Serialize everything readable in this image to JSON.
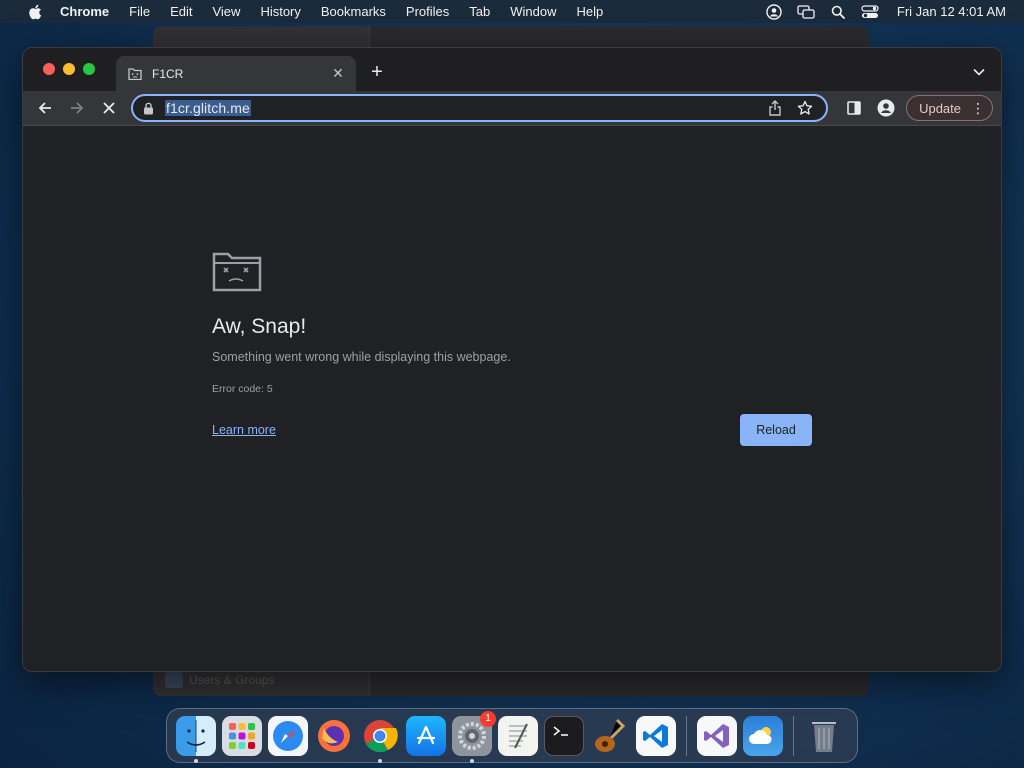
{
  "menubar": {
    "app_name": "Chrome",
    "items": [
      "File",
      "Edit",
      "View",
      "History",
      "Bookmarks",
      "Profiles",
      "Tab",
      "Window",
      "Help"
    ],
    "clock": "Fri Jan 12  4:01 AM"
  },
  "background_window": {
    "sidebar_item": "Users & Groups"
  },
  "browser": {
    "tab": {
      "title": "F1CR",
      "favicon": "sad-folder-icon"
    },
    "omnibox": {
      "url": "f1cr.glitch.me"
    },
    "update_label": "Update"
  },
  "error_page": {
    "title": "Aw, Snap!",
    "message": "Something went wrong while displaying this webpage.",
    "error_code": "Error code: 5",
    "learn_more": "Learn more",
    "reload": "Reload"
  },
  "dock": {
    "items": [
      {
        "name": "Finder",
        "icon": "finder-icon",
        "running": true
      },
      {
        "name": "Launchpad",
        "icon": "launchpad-icon",
        "running": false
      },
      {
        "name": "Safari",
        "icon": "safari-icon",
        "running": false
      },
      {
        "name": "Firefox",
        "icon": "firefox-icon",
        "running": false
      },
      {
        "name": "Chrome",
        "icon": "chrome-icon",
        "running": true
      },
      {
        "name": "App Store",
        "icon": "app-store-icon",
        "running": false
      },
      {
        "name": "System Settings",
        "icon": "system-settings-icon",
        "running": true,
        "badge": "1"
      },
      {
        "name": "TextEdit",
        "icon": "textedit-icon",
        "running": false
      },
      {
        "name": "Terminal",
        "icon": "terminal-icon",
        "running": false
      },
      {
        "name": "Instruments",
        "icon": "instruments-icon",
        "running": false
      },
      {
        "name": "Visual Studio Code",
        "icon": "vscode-icon",
        "running": false
      },
      {
        "name": "Visual Studio",
        "icon": "visual-studio-icon",
        "running": false
      },
      {
        "name": "Weather",
        "icon": "weather-icon",
        "running": false
      },
      {
        "name": "Trash",
        "icon": "trash-icon",
        "running": false
      }
    ]
  },
  "colors": {
    "accent": "#8ab4f8",
    "page_bg": "#202124",
    "toolbar_bg": "#35363a"
  }
}
